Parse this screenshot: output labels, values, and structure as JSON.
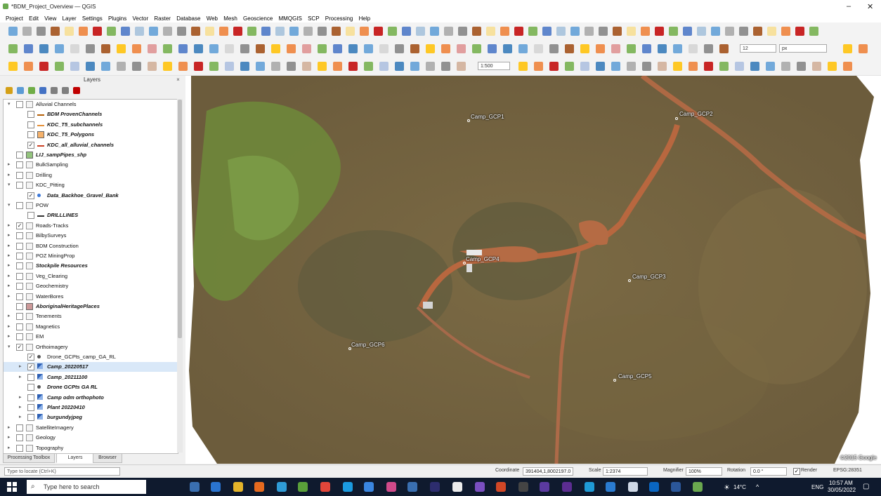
{
  "window": {
    "title": "*BDM_Project_Overview — QGIS",
    "minimize": "–",
    "close": "✕"
  },
  "menu": [
    "Project",
    "Edit",
    "View",
    "Layer",
    "Settings",
    "Plugins",
    "Vector",
    "Raster",
    "Database",
    "Web",
    "Mesh",
    "Geoscience",
    "MMQGIS",
    "SCP",
    "Processing",
    "Help"
  ],
  "toolbars": {
    "label_size": "12",
    "label_unit": "px",
    "text_scale": "1:500"
  },
  "layers_panel": {
    "title": "Layers",
    "close": "×",
    "layers": [
      {
        "label": "Alluvial Channels",
        "kind": "group",
        "checked": false,
        "expanded": true,
        "indent": 0
      },
      {
        "label": "BDM ProvenChannels",
        "kind": "line",
        "checked": false,
        "indent": 1,
        "italic": true,
        "color": "#b45f06"
      },
      {
        "label": "KDC_T5_subchannels",
        "kind": "line",
        "checked": false,
        "indent": 1,
        "italic": true,
        "color": "#e69138"
      },
      {
        "label": "KDC_T5_Polygons",
        "kind": "polygon",
        "checked": false,
        "indent": 1,
        "italic": true,
        "color": "#f6b26b"
      },
      {
        "label": "KDC_all_alluvial_channels",
        "kind": "line",
        "checked": true,
        "indent": 1,
        "italic": true,
        "color": "#cc4125"
      },
      {
        "label": "LIJ_sampPipes_shp",
        "kind": "polygon",
        "checked": false,
        "indent": 0,
        "italic": true,
        "color": "#93c47d"
      },
      {
        "label": "BulkSampling",
        "kind": "group",
        "checked": false,
        "expanded": false,
        "indent": 0
      },
      {
        "label": "Drilling",
        "kind": "group",
        "checked": false,
        "expanded": false,
        "indent": 0
      },
      {
        "label": "KDC_Pitting",
        "kind": "group",
        "checked": false,
        "expanded": true,
        "indent": 0
      },
      {
        "label": "Data_Backhoe_Gravel_Bank",
        "kind": "point",
        "checked": true,
        "indent": 1,
        "italic": true,
        "color": "#3c78d8"
      },
      {
        "label": "POW",
        "kind": "group",
        "checked": false,
        "expanded": true,
        "indent": 0
      },
      {
        "label": "DRILLLINES",
        "kind": "line",
        "checked": false,
        "indent": 1,
        "italic": true,
        "color": "#333333"
      },
      {
        "label": "Roads-Tracks",
        "kind": "group",
        "checked": true,
        "expanded": false,
        "indent": 0
      },
      {
        "label": "BilbySurveys",
        "kind": "group",
        "checked": false,
        "expanded": false,
        "indent": 0
      },
      {
        "label": "BDM Construction",
        "kind": "group",
        "checked": false,
        "expanded": false,
        "indent": 0
      },
      {
        "label": "POZ MiningProp",
        "kind": "group",
        "checked": false,
        "expanded": false,
        "indent": 0
      },
      {
        "label": "Stockpile Resources",
        "kind": "group",
        "checked": false,
        "expanded": false,
        "indent": 0,
        "italic": true
      },
      {
        "label": "Veg_Clearing",
        "kind": "group",
        "checked": false,
        "expanded": false,
        "indent": 0
      },
      {
        "label": "Geochemistry",
        "kind": "group",
        "checked": false,
        "expanded": false,
        "indent": 0
      },
      {
        "label": "WaterBores",
        "kind": "group",
        "checked": false,
        "expanded": false,
        "indent": 0
      },
      {
        "label": "AboriginalHeritagePlaces",
        "kind": "polygon",
        "checked": false,
        "indent": 0,
        "italic": true,
        "color": "#cc9999"
      },
      {
        "label": "Tenements",
        "kind": "group",
        "checked": false,
        "expanded": false,
        "indent": 0
      },
      {
        "label": "Magnetics",
        "kind": "group",
        "checked": false,
        "expanded": false,
        "indent": 0
      },
      {
        "label": "EM",
        "kind": "group",
        "checked": false,
        "expanded": false,
        "indent": 0
      },
      {
        "label": "Orthoimagery",
        "kind": "group",
        "checked": true,
        "expanded": true,
        "indent": 0
      },
      {
        "label": "Drone_GCPts_camp_GA_RL",
        "kind": "point",
        "checked": true,
        "indent": 1,
        "color": "#555555"
      },
      {
        "label": "Camp_20220517",
        "kind": "raster",
        "checked": true,
        "indent": 1,
        "italic": true,
        "selected": true
      },
      {
        "label": "Camp_20211100",
        "kind": "raster",
        "checked": false,
        "indent": 1,
        "italic": true
      },
      {
        "label": "Drone GCPts GA RL",
        "kind": "point",
        "checked": false,
        "indent": 1,
        "italic": true,
        "color": "#555555"
      },
      {
        "label": "Camp odm orthophoto",
        "kind": "raster",
        "checked": false,
        "indent": 1,
        "italic": true
      },
      {
        "label": "Plant 20220410",
        "kind": "raster",
        "checked": false,
        "indent": 1,
        "italic": true
      },
      {
        "label": "burgundyjpeg",
        "kind": "raster",
        "checked": false,
        "indent": 1,
        "italic": true
      },
      {
        "label": "SatelliteImagery",
        "kind": "group",
        "checked": false,
        "expanded": false,
        "indent": 0
      },
      {
        "label": "Geology",
        "kind": "group",
        "checked": false,
        "expanded": false,
        "indent": 0
      },
      {
        "label": "Topography",
        "kind": "group",
        "checked": false,
        "expanded": false,
        "indent": 0
      }
    ],
    "tabs": [
      "Processing Toolbox",
      "Layers",
      "Browser"
    ]
  },
  "map": {
    "gcp_labels": [
      "Camp_GCP1",
      "Camp_GCP2",
      "Camp_GCP3",
      "Camp_GCP4",
      "Camp_GCP5",
      "Camp_GCP6"
    ],
    "copyright": "©2015 Google"
  },
  "statusbar": {
    "locator_placeholder": "Type to locate (Ctrl+K)",
    "coordinate_label": "Coordinate",
    "coordinate": "391404,1,8002197.0",
    "scale_label": "Scale",
    "scale": "1:2374",
    "magnifier_label": "Magnifier",
    "magnifier": "100%",
    "rotation_label": "Rotation",
    "rotation": "0.0 °",
    "render_label": "Render",
    "crs": "EPSG:28351"
  },
  "taskbar": {
    "search_placeholder": "Type here to search",
    "temperature": "14°C",
    "language": "ENG",
    "time": "10:57 AM",
    "date": "30/05/2022"
  }
}
